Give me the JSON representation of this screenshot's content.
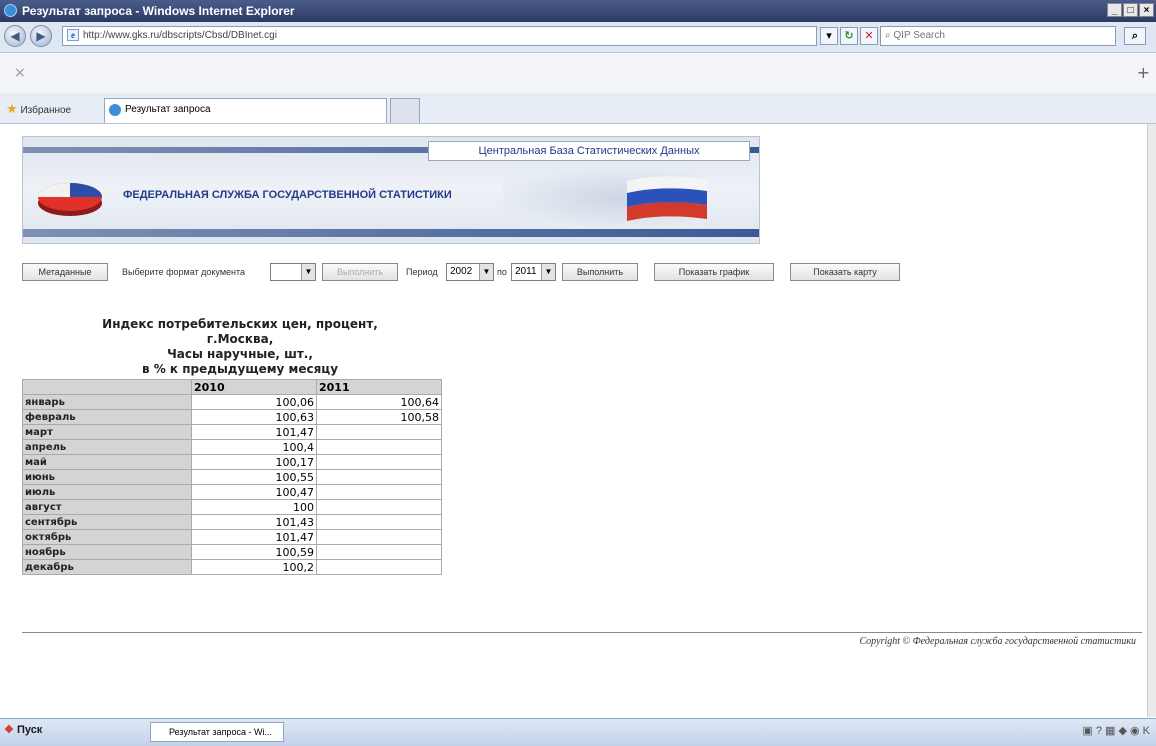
{
  "window": {
    "title": "Результат запроса - Windows Internet Explorer"
  },
  "address": {
    "url": "http://www.gks.ru/dbscripts/Cbsd/DBInet.cgi",
    "search_placeholder": "QIP Search"
  },
  "favorites": {
    "label": "Избранное",
    "tab_title": "Результат запроса"
  },
  "banner": {
    "header": "Центральная База Статистических Данных",
    "org": "ФЕДЕРАЛЬНАЯ СЛУЖБА ГОСУДАРСТВЕННОЙ СТАТИСТИКИ"
  },
  "controls": {
    "metadata": "Метаданные",
    "format_label": "Выберите формат документа",
    "format_value": "",
    "execute_disabled": "Выполнить",
    "period_label": "Период",
    "period_from": "2002",
    "to_label": "по",
    "period_to": "2011",
    "execute": "Выполнить",
    "show_chart": "Показать график",
    "show_map": "Показать карту"
  },
  "table": {
    "title_lines": [
      "Индекс потребительских цен, процент,",
      "г.Москва,",
      "Часы наручные, шт.,",
      "в % к предыдущему месяцу"
    ],
    "columns": [
      "2010",
      "2011"
    ],
    "rows": [
      {
        "month": "январь",
        "v2010": "100,06",
        "v2011": "100,64"
      },
      {
        "month": "февраль",
        "v2010": "100,63",
        "v2011": "100,58"
      },
      {
        "month": "март",
        "v2010": "101,47",
        "v2011": ""
      },
      {
        "month": "апрель",
        "v2010": "100,4",
        "v2011": ""
      },
      {
        "month": "май",
        "v2010": "100,17",
        "v2011": ""
      },
      {
        "month": "июнь",
        "v2010": "100,55",
        "v2011": ""
      },
      {
        "month": "июль",
        "v2010": "100,47",
        "v2011": ""
      },
      {
        "month": "август",
        "v2010": "100",
        "v2011": ""
      },
      {
        "month": "сентябрь",
        "v2010": "101,43",
        "v2011": ""
      },
      {
        "month": "октябрь",
        "v2010": "101,47",
        "v2011": ""
      },
      {
        "month": "ноябрь",
        "v2010": "100,59",
        "v2011": ""
      },
      {
        "month": "декабрь",
        "v2010": "100,2",
        "v2011": ""
      }
    ]
  },
  "footer": {
    "copyright": "Copyright © Федеральная служба государственной статистики"
  },
  "taskbar": {
    "start": "Пуск",
    "task": "Результат запроса - Wi..."
  }
}
